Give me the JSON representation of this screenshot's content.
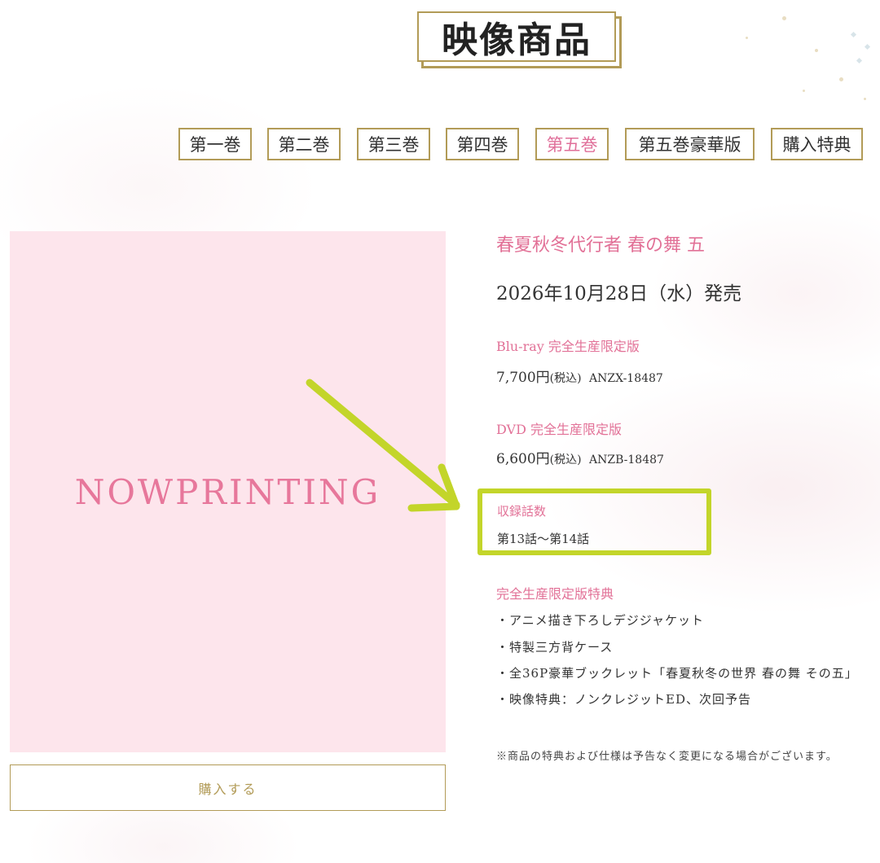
{
  "page": {
    "title": "映像商品",
    "colors": {
      "accent_pink": "#e27197",
      "gold": "#b29b57",
      "highlight": "#c3d52a",
      "jacket_bg": "#fde5ec"
    }
  },
  "tabs": [
    {
      "label": "第一巻",
      "active": false
    },
    {
      "label": "第二巻",
      "active": false
    },
    {
      "label": "第三巻",
      "active": false
    },
    {
      "label": "第四巻",
      "active": false
    },
    {
      "label": "第五巻",
      "active": true
    },
    {
      "label": "第五巻豪華版",
      "active": false
    },
    {
      "label": "購入特典",
      "active": false
    }
  ],
  "jacket": {
    "placeholder": "NOWPRINTING"
  },
  "buy_button": {
    "label": "購入する"
  },
  "product": {
    "title": "春夏秋冬代行者 春の舞 五",
    "release": "2026年10月28日（水）発売",
    "bluray": {
      "label": "Blu-ray 完全生産限定版",
      "price": "7,700円",
      "tax": "(税込)",
      "code": "ANZX-18487"
    },
    "dvd": {
      "label": "DVD 完全生産限定版",
      "price": "6,600円",
      "tax": "(税込)",
      "code": "ANZB-18487"
    },
    "episodes": {
      "label": "収録話数",
      "value": "第13話〜第14話"
    },
    "bonus": {
      "label": "完全生産限定版特典",
      "items": [
        "・アニメ描き下ろしデジジャケット",
        "・特製三方背ケース",
        "・全36P豪華ブックレット「春夏秋冬の世界 春の舞 その五」",
        "・映像特典：ノンクレジットED、次回予告"
      ]
    },
    "note": "※商品の特典および仕様は予告なく変更になる場合がございます。"
  },
  "annotation": {
    "icon": "green-arrow-icon"
  }
}
